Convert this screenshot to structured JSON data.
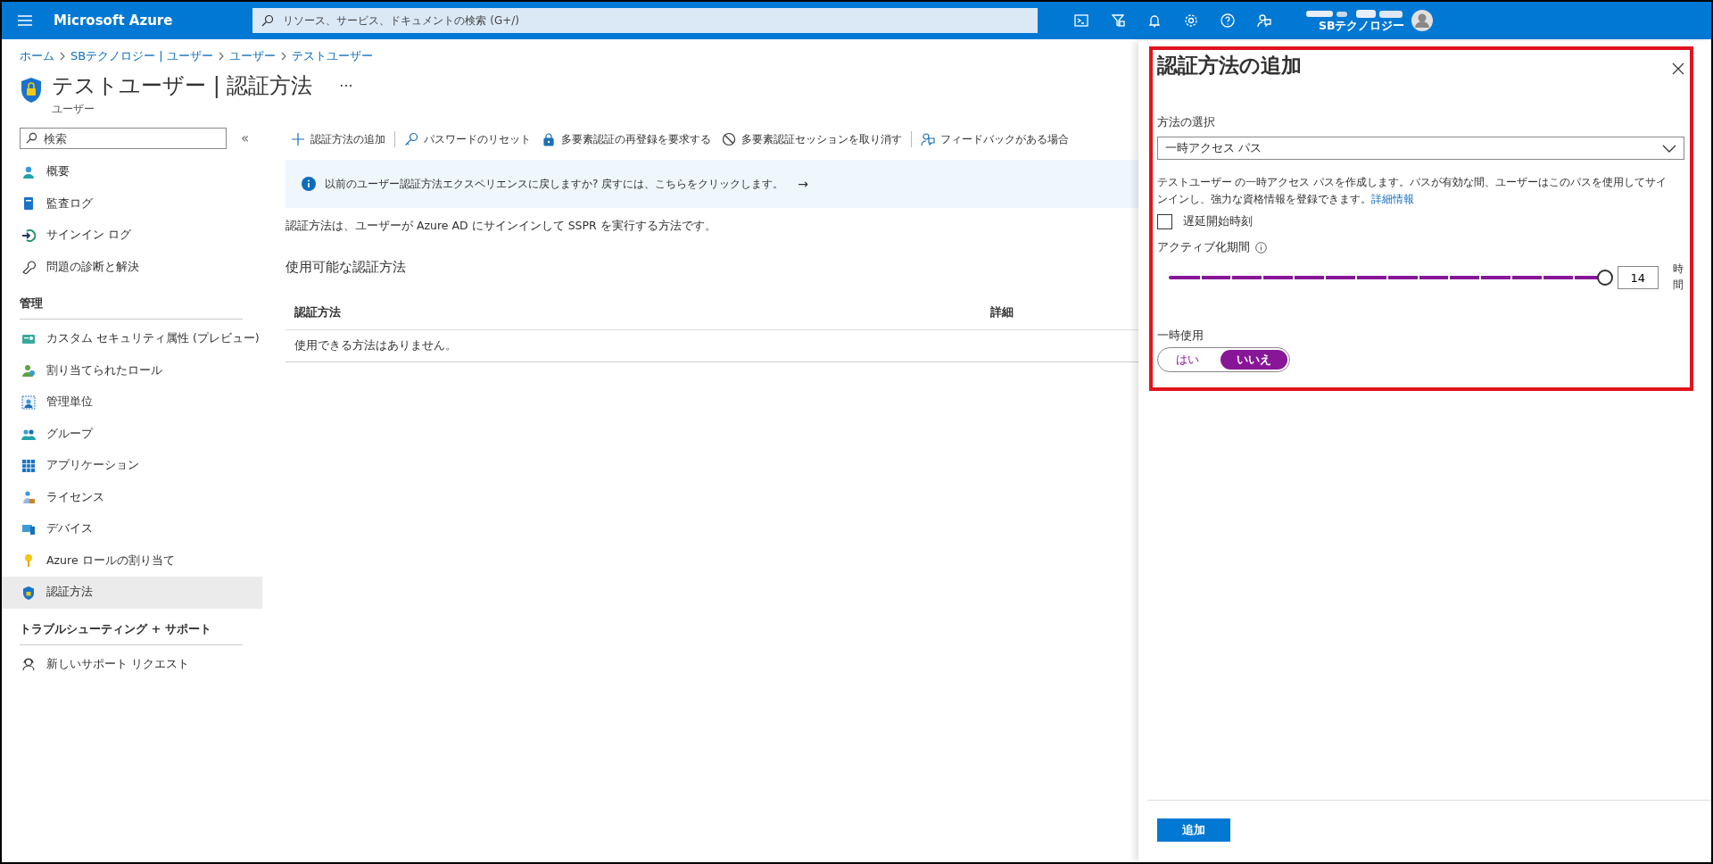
{
  "top_bar": {
    "brand": "Microsoft Azure",
    "search": {
      "placeholder": "リソース、サービス、ドキュメントの検索 (G+/)"
    },
    "account": {
      "directory": "SBテクノロジー"
    }
  },
  "breadcrumb": [
    "ホーム",
    "SBテクノロジー | ユーザー",
    "ユーザー",
    "テストユーザー"
  ],
  "page": {
    "title": "テストユーザー | 認証方法",
    "more": "···",
    "subtitle": "ユーザー"
  },
  "sidebar": {
    "search": {
      "placeholder": "検索"
    },
    "collapse": "«",
    "sections": [
      {
        "items": [
          {
            "label": "概要",
            "kind": "person",
            "selected": false
          },
          {
            "label": "監査ログ",
            "kind": "book",
            "selected": false
          },
          {
            "label": "サインイン ログ",
            "kind": "signin",
            "selected": false
          },
          {
            "label": "問題の診断と解決",
            "kind": "wrench",
            "selected": false
          }
        ]
      },
      {
        "heading": "管理",
        "items": [
          {
            "label": "カスタム セキュリティ属性 (プレビュー)",
            "kind": "card",
            "selected": false
          },
          {
            "label": "割り当てられたロール",
            "kind": "role",
            "selected": false
          },
          {
            "label": "管理単位",
            "kind": "unit",
            "selected": false
          },
          {
            "label": "グループ",
            "kind": "group",
            "selected": false
          },
          {
            "label": "アプリケーション",
            "kind": "grid",
            "selected": false
          },
          {
            "label": "ライセンス",
            "kind": "license",
            "selected": false
          },
          {
            "label": "デバイス",
            "kind": "device",
            "selected": false
          },
          {
            "label": "Azure ロールの割り当て",
            "kind": "key",
            "selected": false
          },
          {
            "label": "認証方法",
            "kind": "shield",
            "selected": true
          }
        ]
      },
      {
        "heading": "トラブルシューティング + サポート",
        "items": [
          {
            "label": "新しいサポート リクエスト",
            "kind": "support",
            "selected": false
          }
        ]
      }
    ]
  },
  "toolbar": [
    {
      "label": "認証方法の追加",
      "kind": "plus",
      "divider_before": false
    },
    {
      "label": "パスワードのリセット",
      "kind": "key",
      "divider_before": true
    },
    {
      "label": "多要素認証の再登録を要求する",
      "kind": "lock",
      "divider_before": false
    },
    {
      "label": "多要素認証セッションを取り消す",
      "kind": "block",
      "divider_before": false
    },
    {
      "label": "フィードバックがある場合",
      "kind": "feedback",
      "divider_before": true
    }
  ],
  "banner": {
    "text": "以前のユーザー認証方法エクスペリエンスに戻しますか? 戻すには、こちらをクリックします。",
    "arrow": "→"
  },
  "description": "認証方法は、ユーザーが Azure AD にサインインして SSPR を実行する方法です。",
  "section_title": "使用可能な認証方法",
  "table": {
    "columns": [
      "認証方法",
      "詳細"
    ],
    "empty": "使用できる方法はありません。"
  },
  "panel": {
    "title": "認証方法の追加",
    "method": {
      "label": "方法の選択",
      "value": "一時アクセス パス"
    },
    "info": "テストユーザー の一時アクセス パスを作成します。パスが有効な間、ユーザーはこのパスを使用してサインインし、強力な資格情報を登録できます。",
    "link": "詳細情報",
    "delayed_start": {
      "label": "遅延開始時刻",
      "checked": false
    },
    "duration": {
      "label": "アクティブ化期間",
      "level": 1,
      "value": "14",
      "unit": "時間"
    },
    "one_time": {
      "label": "一時使用",
      "options": [
        {
          "label": "はい",
          "selected": false
        },
        {
          "label": "いいえ",
          "selected": true
        }
      ]
    },
    "submit": "追加"
  }
}
